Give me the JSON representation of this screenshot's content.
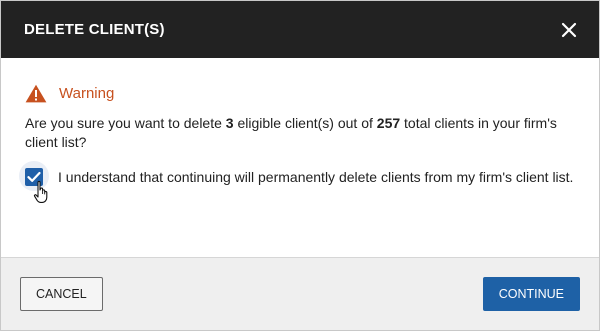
{
  "dialog": {
    "title": "DELETE CLIENT(S)",
    "close_icon": "close-icon"
  },
  "warning": {
    "icon": "warning-triangle-icon",
    "label": "Warning",
    "color": "#c7511f"
  },
  "message": {
    "prefix": "Are you sure you want to delete ",
    "eligible_count": "3",
    "middle": " eligible client(s) out of ",
    "total_count": "257",
    "suffix": " total clients in your firm's client list?"
  },
  "confirm": {
    "checked": true,
    "label": "I understand that continuing will permanently delete clients from my firm's client list."
  },
  "footer": {
    "cancel_label": "CANCEL",
    "continue_label": "CONTINUE"
  },
  "colors": {
    "header_bg": "#222222",
    "accent": "#1e61a6",
    "footer_bg": "#efefef"
  }
}
